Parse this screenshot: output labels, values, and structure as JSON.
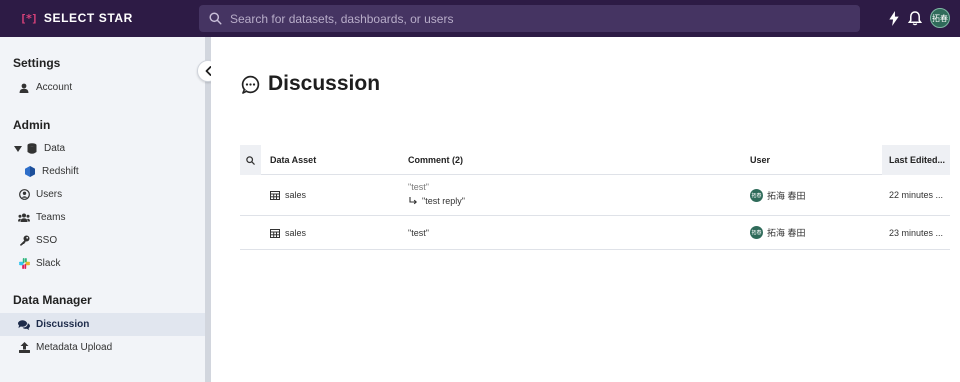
{
  "app": {
    "logo_mark": "[*]",
    "logo_text": "SELECT STAR"
  },
  "search": {
    "placeholder": "Search for datasets, dashboards, or users"
  },
  "user": {
    "avatar_initials": "拓春"
  },
  "sidebar": {
    "settings_title": "Settings",
    "account": "Account",
    "admin_title": "Admin",
    "data": "Data",
    "redshift": "Redshift",
    "users": "Users",
    "teams": "Teams",
    "sso": "SSO",
    "slack": "Slack",
    "data_manager_title": "Data Manager",
    "discussion": "Discussion",
    "metadata_upload": "Metadata Upload"
  },
  "page": {
    "title": "Discussion"
  },
  "table": {
    "headers": {
      "data_asset": "Data Asset",
      "comment": "Comment (2)",
      "user": "User",
      "last_edited": "Last Edited..."
    },
    "rows": [
      {
        "asset": "sales",
        "comment": "\"test\"",
        "reply": "\"test reply\"",
        "user": "拓海 春田",
        "user_initials": "拓春",
        "edited": "22 minutes ..."
      },
      {
        "asset": "sales",
        "comment": "\"test\"",
        "user": "拓海 春田",
        "user_initials": "拓春",
        "edited": "23 minutes ..."
      }
    ]
  },
  "colors": {
    "topbar": "#2d1b45",
    "brand_accent": "#d9427a",
    "sidebar_bg": "#f2f4f8",
    "active_item": "#e1e6ef"
  }
}
